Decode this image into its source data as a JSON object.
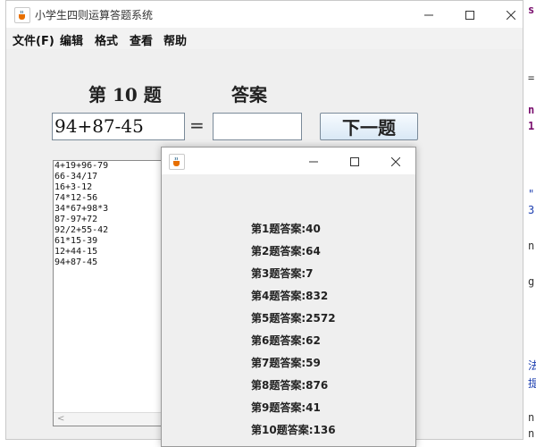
{
  "main_window": {
    "title": "小学生四则运算答题系统",
    "menus": [
      "文件(F)",
      "编辑",
      "格式",
      "查看",
      "帮助"
    ],
    "question_label": "第 10 题",
    "answer_label": "答案",
    "current_question": "94+87-45",
    "equals": "=",
    "answer_value": "",
    "next_button": "下一题",
    "history": [
      "4+19+96-79",
      "66-34/17",
      "16+3-12",
      "74*12-56",
      "34*67+98*3",
      "87-97+72",
      "92/2+55-42",
      "61*15-39",
      "12+44-15",
      "94+87-45"
    ]
  },
  "answer_window": {
    "title": "",
    "answers": [
      "第1题答案:40",
      "第2题答案:64",
      "第3题答案:7",
      "第4题答案:832",
      "第5题答案:2572",
      "第6题答案:62",
      "第7题答案:59",
      "第8题答案:876",
      "第9题答案:41",
      "第10题答案:136"
    ]
  },
  "icons": {
    "app": "java-cup-icon",
    "minimize": "minimize-icon",
    "maximize": "maximize-icon",
    "close": "close-icon"
  },
  "colors": {
    "window_bg": "#efefef",
    "button_gradient": "#d9e8f5"
  }
}
